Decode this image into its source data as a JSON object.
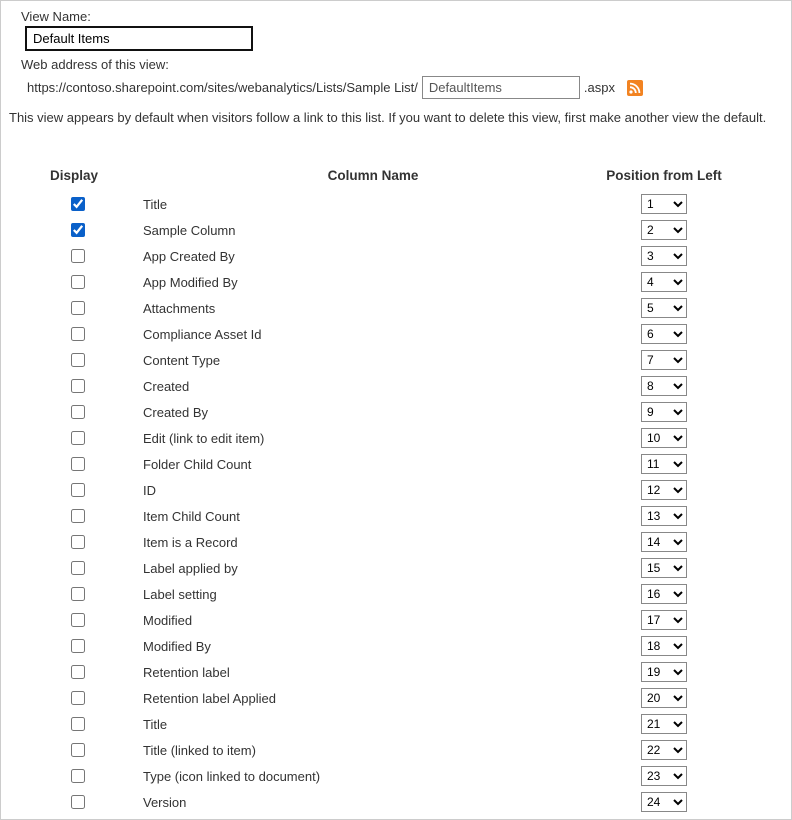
{
  "labels": {
    "view_name": "View Name:",
    "web_address": "Web address of this view:",
    "web_address_prefix": "https://contoso.sharepoint.com/sites/webanalytics/Lists/Sample List/",
    "aspx": ".aspx",
    "description": "This view appears by default when visitors follow a link to this list. If you want to delete this view, first make another view the default."
  },
  "values": {
    "view_name": "Default Items",
    "slug": "DefaultItems"
  },
  "headers": {
    "display": "Display",
    "column_name": "Column Name",
    "position": "Position from Left"
  },
  "rss_icon": "rss-icon",
  "columns": [
    {
      "checked": true,
      "name": "Title",
      "pos": "1"
    },
    {
      "checked": true,
      "name": "Sample Column",
      "pos": "2"
    },
    {
      "checked": false,
      "name": "App Created By",
      "pos": "3"
    },
    {
      "checked": false,
      "name": "App Modified By",
      "pos": "4"
    },
    {
      "checked": false,
      "name": "Attachments",
      "pos": "5"
    },
    {
      "checked": false,
      "name": "Compliance Asset Id",
      "pos": "6"
    },
    {
      "checked": false,
      "name": "Content Type",
      "pos": "7"
    },
    {
      "checked": false,
      "name": "Created",
      "pos": "8"
    },
    {
      "checked": false,
      "name": "Created By",
      "pos": "9"
    },
    {
      "checked": false,
      "name": "Edit (link to edit item)",
      "pos": "10"
    },
    {
      "checked": false,
      "name": "Folder Child Count",
      "pos": "11"
    },
    {
      "checked": false,
      "name": "ID",
      "pos": "12"
    },
    {
      "checked": false,
      "name": "Item Child Count",
      "pos": "13"
    },
    {
      "checked": false,
      "name": "Item is a Record",
      "pos": "14"
    },
    {
      "checked": false,
      "name": "Label applied by",
      "pos": "15"
    },
    {
      "checked": false,
      "name": "Label setting",
      "pos": "16"
    },
    {
      "checked": false,
      "name": "Modified",
      "pos": "17"
    },
    {
      "checked": false,
      "name": "Modified By",
      "pos": "18"
    },
    {
      "checked": false,
      "name": "Retention label",
      "pos": "19"
    },
    {
      "checked": false,
      "name": "Retention label Applied",
      "pos": "20"
    },
    {
      "checked": false,
      "name": "Title",
      "pos": "21"
    },
    {
      "checked": false,
      "name": "Title (linked to item)",
      "pos": "22"
    },
    {
      "checked": false,
      "name": "Type (icon linked to document)",
      "pos": "23"
    },
    {
      "checked": false,
      "name": "Version",
      "pos": "24"
    }
  ]
}
